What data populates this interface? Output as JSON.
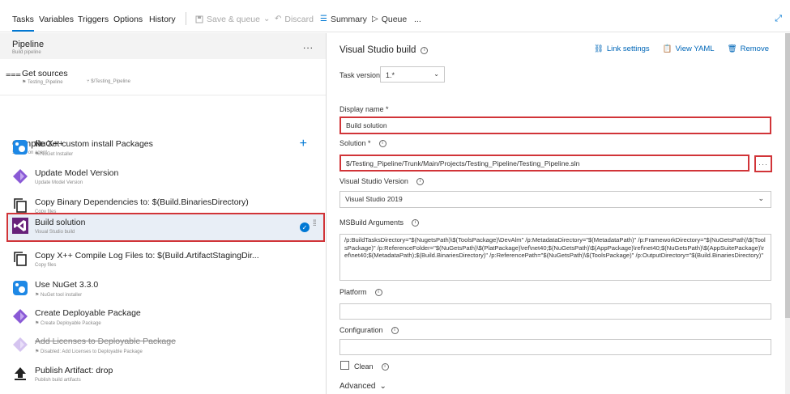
{
  "toolbar": {
    "tabs": [
      "Tasks",
      "Variables",
      "Triggers",
      "Options",
      "History"
    ],
    "save_queue": "Save & queue",
    "discard": "Discard",
    "summary": "Summary",
    "queue": "Queue",
    "more": "..."
  },
  "pipeline": {
    "title": "Pipeline",
    "subtitle": "Build pipeline",
    "more": "..."
  },
  "get_sources": {
    "title": "Get sources",
    "repo": "Testing_Pipeline",
    "path": "$/Testing_Pipeline"
  },
  "phase": {
    "title": "Compile X++",
    "subtitle": "Run on agent",
    "add": "+"
  },
  "tasks": [
    {
      "title": "NuGet custom install Packages",
      "subtitle": "NuGet Installer",
      "icon": "nuget-icon"
    },
    {
      "title": "Update Model Version",
      "subtitle": "Update Model Version",
      "icon": "powerapps-icon"
    },
    {
      "title": "Copy Binary Dependencies to: $(Build.BinariesDirectory)",
      "subtitle": "Copy files",
      "icon": "copy-icon"
    },
    {
      "title": "Build solution",
      "subtitle": "Visual Studio build",
      "icon": "visual-studio-icon"
    },
    {
      "title": "Copy X++ Compile Log Files to: $(Build.ArtifactStagingDir...",
      "subtitle": "Copy files",
      "icon": "copy-icon"
    },
    {
      "title": "Use NuGet 3.3.0",
      "subtitle": "NuGet tool installer",
      "icon": "nuget-icon"
    },
    {
      "title": "Create Deployable Package",
      "subtitle": "Create Deployable Package",
      "icon": "powerapps-icon"
    },
    {
      "title": "Add Licenses to Deployable Package",
      "subtitle": "Disabled: Add Licenses to Deployable Package",
      "icon": "powerapps-icon"
    },
    {
      "title": "Publish Artifact: drop",
      "subtitle": "Publish build artifacts",
      "icon": "upload-icon"
    }
  ],
  "detail": {
    "title": "Visual Studio build",
    "link_settings": "Link settings",
    "view_yaml": "View YAML",
    "remove": "Remove",
    "task_version_label": "Task version",
    "task_version_value": "1.*",
    "display_name_label": "Display name *",
    "display_name_value": "Build solution",
    "solution_label": "Solution *",
    "solution_value": "$/Testing_Pipeline/Trunk/Main/Projects/Testing_Pipeline/Testing_Pipeline.sln",
    "solution_browse": "···",
    "vs_version_label": "Visual Studio Version",
    "vs_version_value": "Visual Studio 2019",
    "msbuild_label": "MSBuild Arguments",
    "msbuild_value": "/p:BuildTasksDirectory=\"$(NugetsPath)\\$(ToolsPackage)\\DevAlm\" /p:MetadataDirectory=\"$(MetadataPath)\" /p:FrameworkDirectory=\"$(NuGetsPath)\\$(ToolsPackage)\" /p:ReferenceFolder=\"$(NuGetsPath)\\$(PlatPackage)\\ref\\net40;$(NuGetsPath)\\$(AppPackage)\\ref\\net40;$(NuGetsPath)\\$(AppSuitePackage)\\ref\\net40;$(MetadataPath);$(Build.BinariesDirectory)\" /p:ReferencePath=\"$(NuGetsPath)\\$(ToolsPackage)\" /p:OutputDirectory=\"$(Build.BinariesDirectory)\"",
    "platform_label": "Platform",
    "configuration_label": "Configuration",
    "clean_label": "Clean",
    "advanced_label": "Advanced"
  }
}
